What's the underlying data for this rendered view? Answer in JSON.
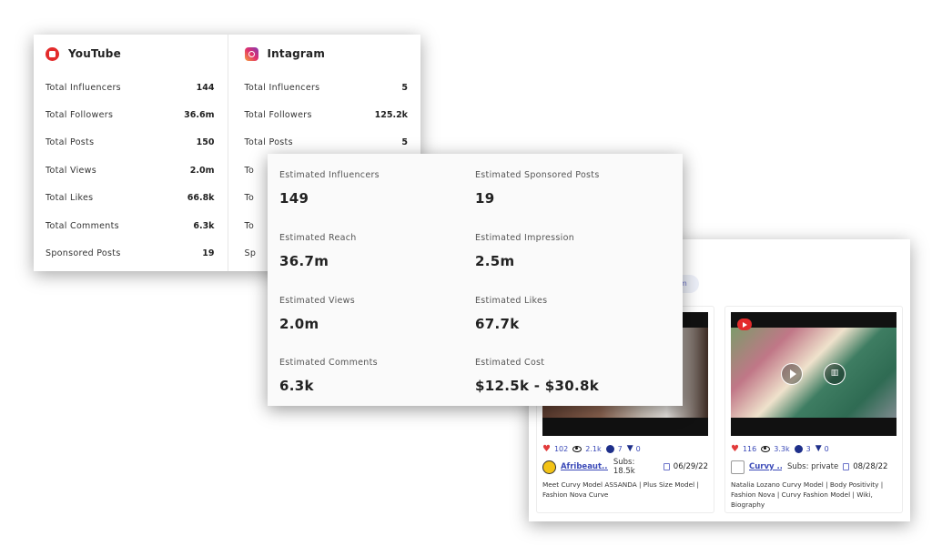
{
  "platforms": [
    {
      "name": "YouTube",
      "icon": "youtube-icon",
      "stats": [
        {
          "label": "Total Influencers",
          "value": "144"
        },
        {
          "label": "Total Followers",
          "value": "36.6m"
        },
        {
          "label": "Total Posts",
          "value": "150"
        },
        {
          "label": "Total Views",
          "value": "2.0m"
        },
        {
          "label": "Total Likes",
          "value": "66.8k"
        },
        {
          "label": "Total Comments",
          "value": "6.3k"
        },
        {
          "label": "Sponsored Posts",
          "value": "19"
        }
      ]
    },
    {
      "name": "Intagram",
      "icon": "instagram-icon",
      "stats": [
        {
          "label": "Total Influencers",
          "value": "5"
        },
        {
          "label": "Total Followers",
          "value": "125.2k"
        },
        {
          "label": "Total Posts",
          "value": "5"
        },
        {
          "label": "To",
          "value": ""
        },
        {
          "label": "To",
          "value": ""
        },
        {
          "label": "To",
          "value": ""
        },
        {
          "label": "Sp",
          "value": ""
        }
      ]
    }
  ],
  "estimates": [
    {
      "label": "Estimated Influencers",
      "value": "149"
    },
    {
      "label": "Estimated Sponsored Posts",
      "value": "19"
    },
    {
      "label": "Estimated Reach",
      "value": "36.7m"
    },
    {
      "label": "Estimated Impression",
      "value": "2.5m"
    },
    {
      "label": "Estimated Views",
      "value": "2.0m"
    },
    {
      "label": "Estimated Likes",
      "value": "67.7k"
    },
    {
      "label": "Estimated Comments",
      "value": "6.3k"
    },
    {
      "label": "Estimated Cost",
      "value": "$12.5k - $30.8k"
    }
  ],
  "videos": {
    "chip_text": "m",
    "items": [
      {
        "likes": "102",
        "views": "2.1k",
        "comments": "7",
        "dislikes": "0",
        "channel": "Afribeaut...",
        "subs": "Subs: 18.5k",
        "date": "06/29/22",
        "title": "Meet Curvy Model ASSANDA | Plus Size Model | Fashion Nova Curve"
      },
      {
        "likes": "116",
        "views": "3.3k",
        "comments": "3",
        "dislikes": "0",
        "channel": "Curvy ...",
        "subs": "Subs: private",
        "date": "08/28/22",
        "title": "Natalia Lozano Curvy Model | Body Positivity | Fashion Nova | Curvy Fashion Model | Wiki, Biography"
      }
    ]
  }
}
